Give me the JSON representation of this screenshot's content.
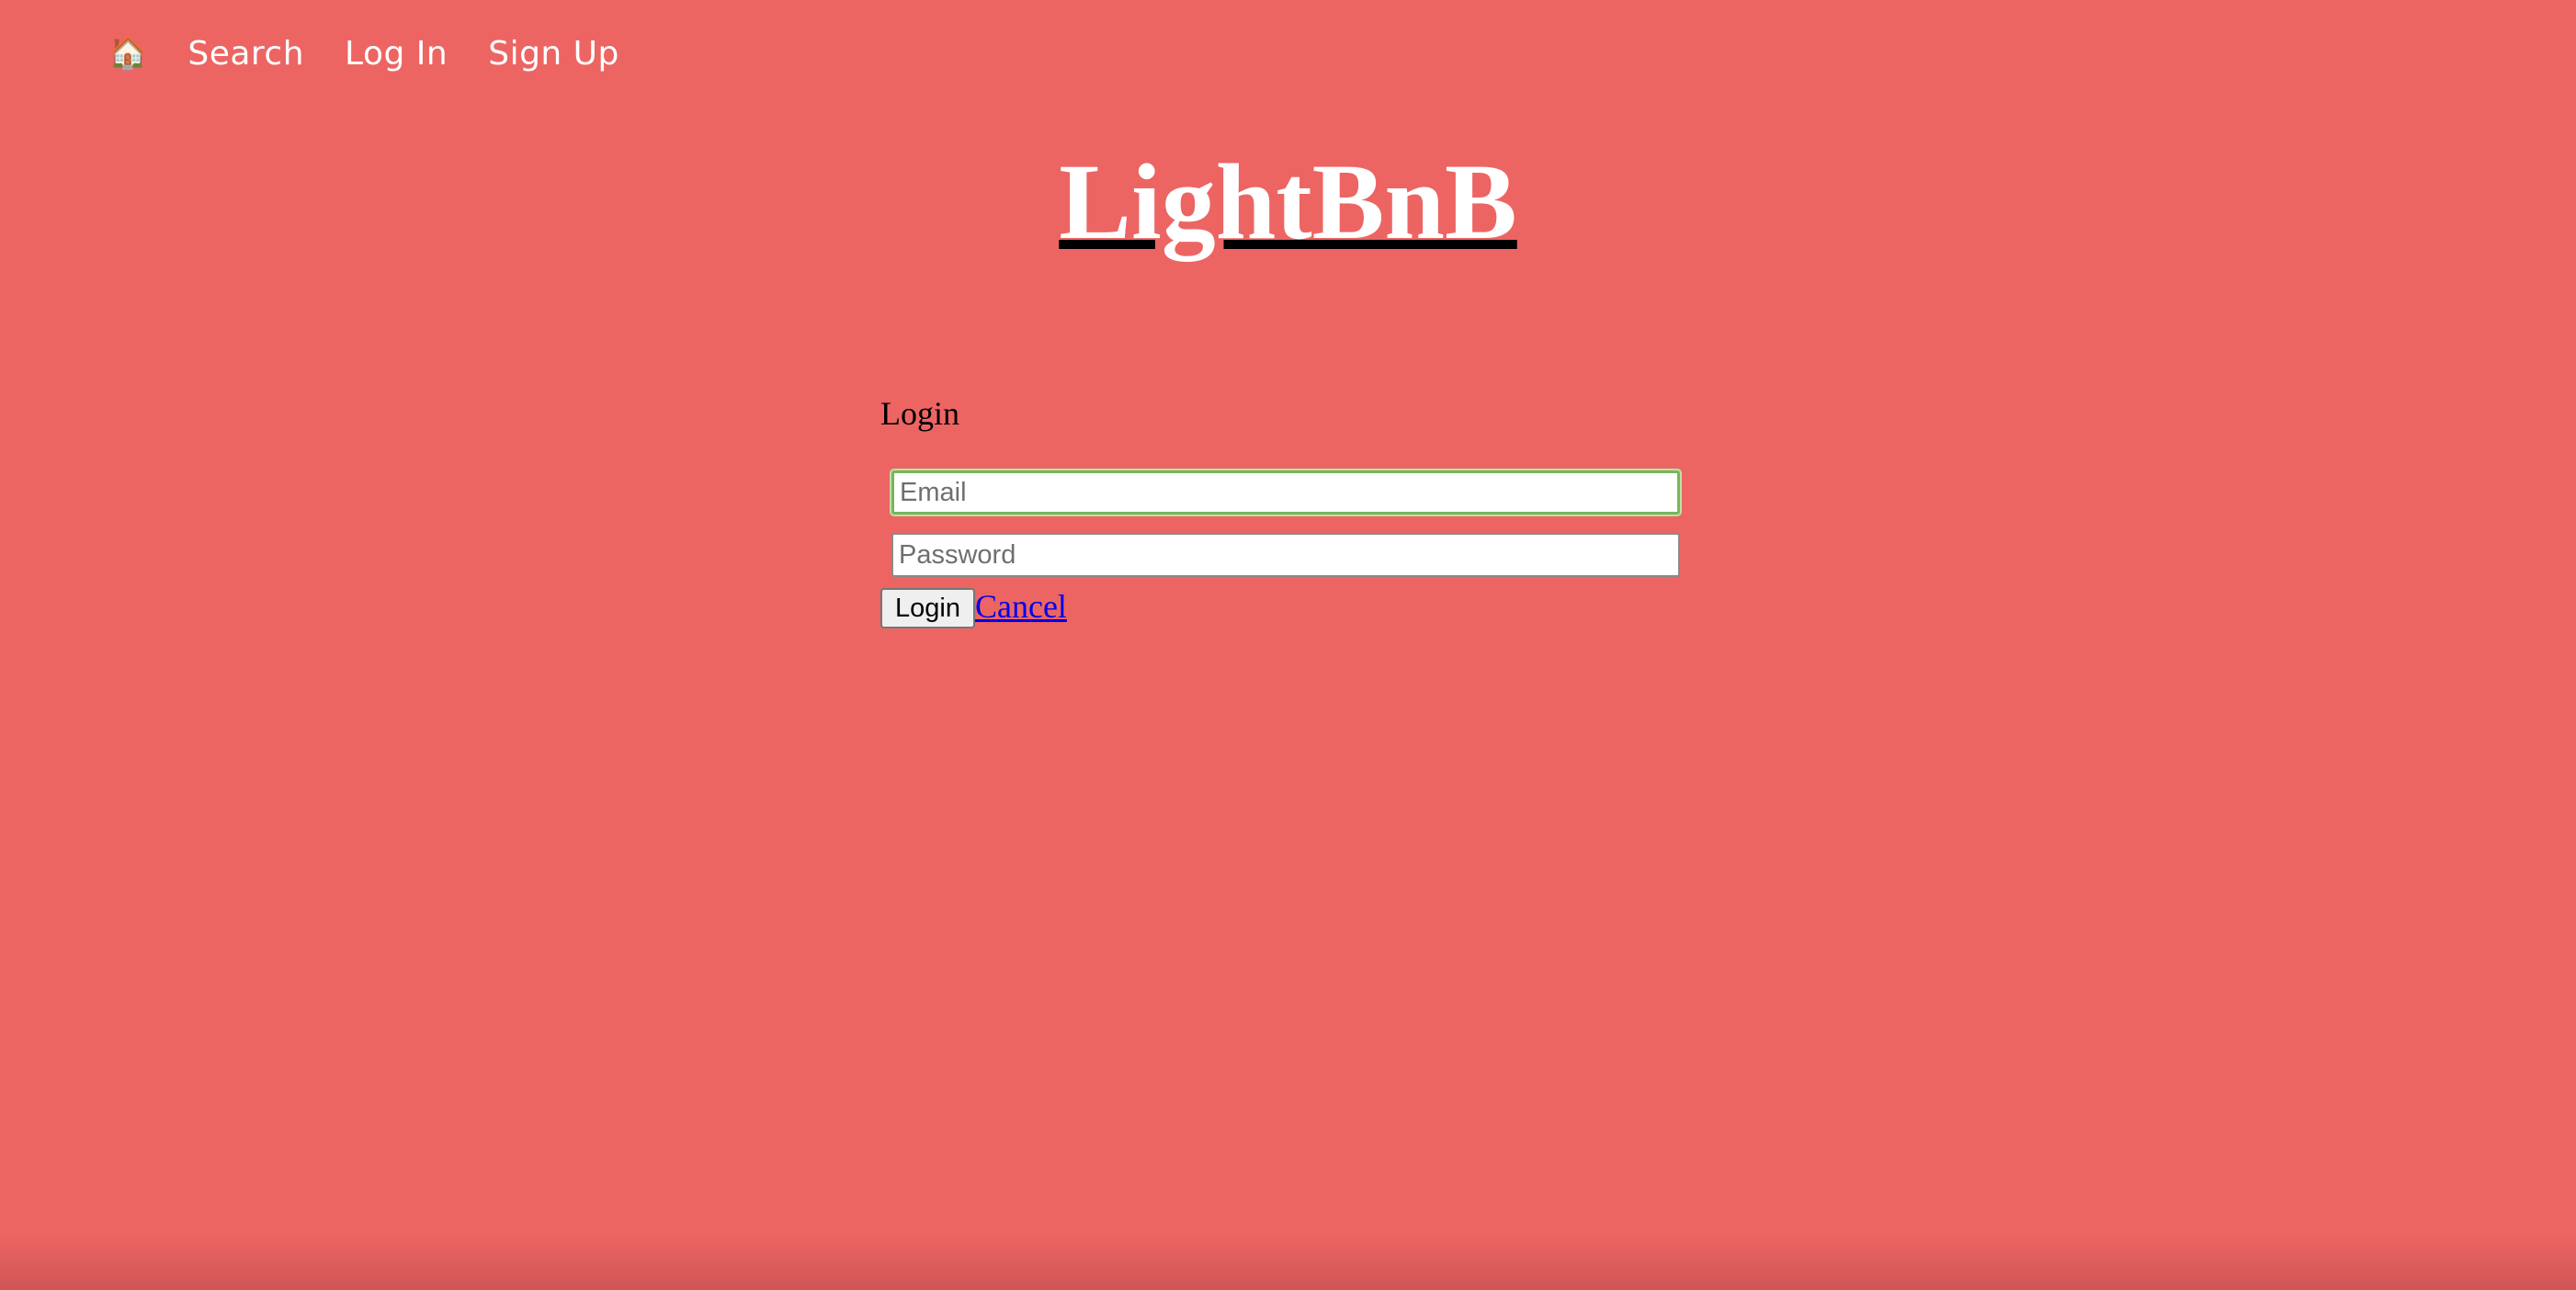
{
  "nav": {
    "home_icon": "🏠",
    "home_icon_name": "house-icon",
    "links": [
      "Search",
      "Log In",
      "Sign Up"
    ]
  },
  "title": "LightBnB",
  "login": {
    "heading": "Login",
    "email_placeholder": "Email",
    "password_placeholder": "Password",
    "submit_label": "Login",
    "cancel_label": "Cancel"
  },
  "colors": {
    "background": "#ec6563",
    "link": "#0000ee"
  }
}
